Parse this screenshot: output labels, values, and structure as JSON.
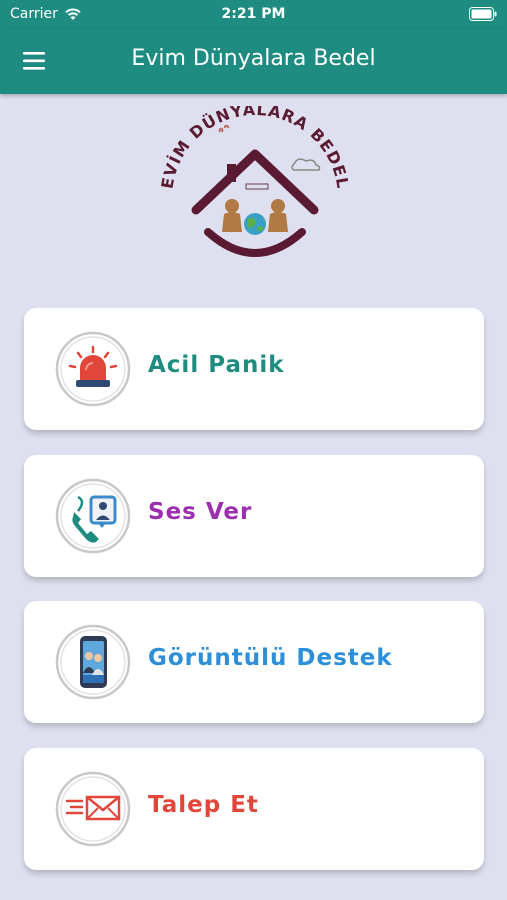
{
  "status_bar": {
    "carrier": "Carrier",
    "time": "2:21 PM"
  },
  "app_bar": {
    "title": "Evim Dünyalara Bedel",
    "menu_icon": "hamburger-menu-icon"
  },
  "logo": {
    "text": "EVİM DÜNYALARA BEDEL",
    "colors": {
      "brand": "#5a1a32",
      "figures": "#b07a45",
      "globe": "#3aa0c8"
    }
  },
  "colors": {
    "primary": "#1e8c80",
    "background": "#dfe0ef"
  },
  "menu": [
    {
      "label": "Acil Panik",
      "icon": "siren-alarm-icon",
      "color": "#1e8c80"
    },
    {
      "label": "Ses Ver",
      "icon": "phone-call-icon",
      "color": "#9b2fae"
    },
    {
      "label": "Görüntülü Destek",
      "icon": "video-call-phone-icon",
      "color": "#2e8fd9"
    },
    {
      "label": "Talep Et",
      "icon": "send-mail-icon",
      "color": "#e0473a"
    }
  ]
}
